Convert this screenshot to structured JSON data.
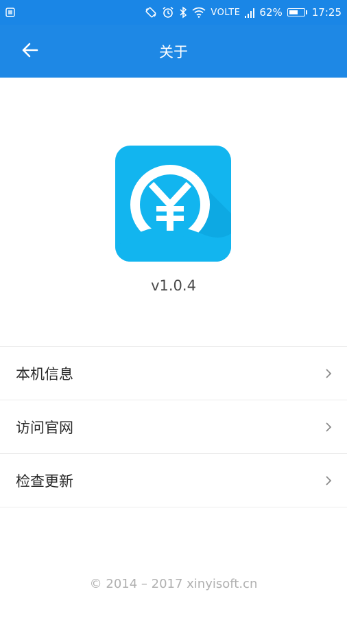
{
  "status_bar": {
    "signal_label": "VOLTE",
    "battery": "62%",
    "battery_level": 0.62,
    "time": "17:25",
    "icons": [
      "screenshot-icon",
      "rotate-icon",
      "alarm-icon",
      "bluetooth-icon",
      "wifi-icon",
      "signal-icon",
      "battery-icon"
    ]
  },
  "app_bar": {
    "title": "关于",
    "back_icon": "arrow-left-icon"
  },
  "about": {
    "logo_icon": "yuan-coin-logo",
    "version": "v1.0.4"
  },
  "menu": {
    "items": [
      {
        "label": "本机信息"
      },
      {
        "label": "访问官网"
      },
      {
        "label": "检查更新"
      }
    ]
  },
  "footer": {
    "copyright": "© 2014 – 2017 xinyisoft.cn"
  },
  "colors": {
    "primary": "#1e88e5",
    "status_bar": "#1a86e6",
    "logo_bg": "#12b5ef"
  }
}
